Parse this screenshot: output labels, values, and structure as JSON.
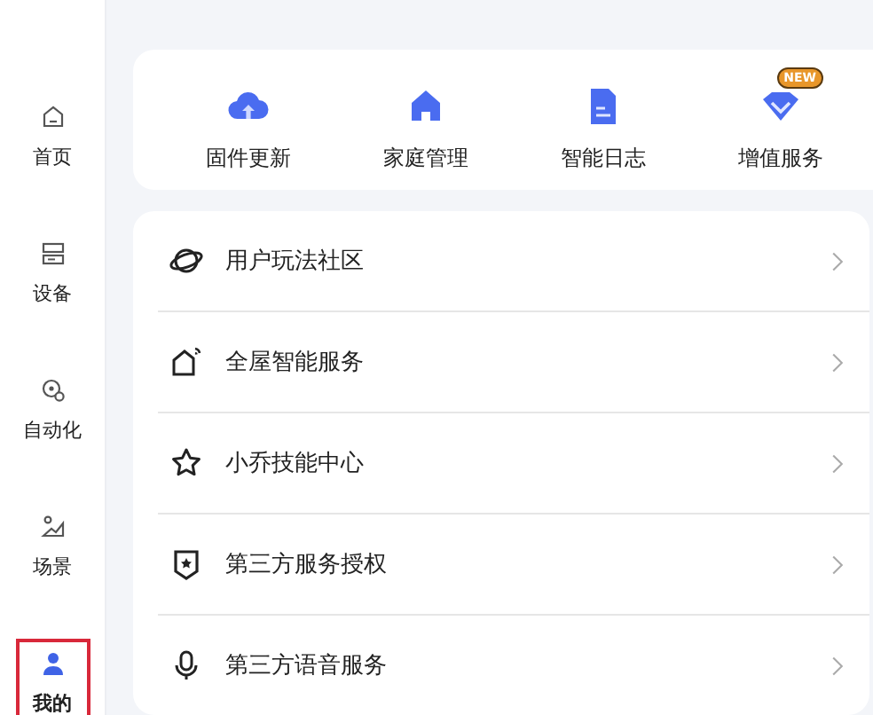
{
  "sidebar": {
    "items": [
      {
        "label": "首页",
        "kind": "home",
        "selected": false
      },
      {
        "label": "设备",
        "kind": "device",
        "selected": false
      },
      {
        "label": "自动化",
        "kind": "automation",
        "selected": false
      },
      {
        "label": "场景",
        "kind": "scene",
        "selected": false
      },
      {
        "label": "我的",
        "kind": "me",
        "selected": true
      }
    ]
  },
  "quick_actions": [
    {
      "label": "固件更新",
      "kind": "cloud"
    },
    {
      "label": "家庭管理",
      "kind": "house"
    },
    {
      "label": "智能日志",
      "kind": "doc"
    },
    {
      "label": "增值服务",
      "kind": "diamond",
      "badge": "NEW"
    }
  ],
  "menu": [
    {
      "label": "用户玩法社区",
      "kind": "planet"
    },
    {
      "label": "全屋智能服务",
      "kind": "smarthome"
    },
    {
      "label": "小乔技能中心",
      "kind": "star"
    },
    {
      "label": "第三方服务授权",
      "kind": "shield"
    },
    {
      "label": "第三方语音服务",
      "kind": "mic"
    }
  ]
}
